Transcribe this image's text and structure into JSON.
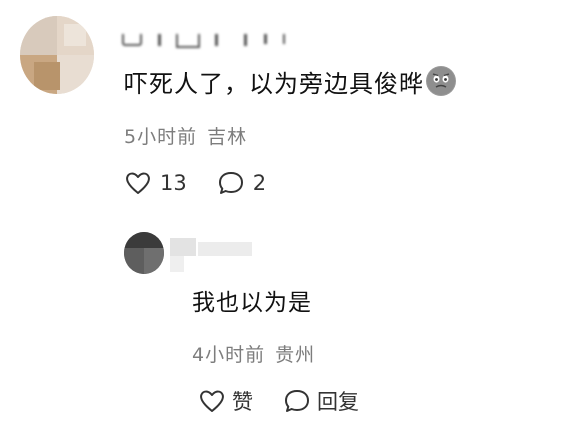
{
  "comment": {
    "text": "吓死人了，以为旁边具俊晔",
    "emoji_icon": "grimace-face-emoji",
    "time": "5小时前",
    "location": "吉林",
    "likes": "13",
    "replies": "2"
  },
  "reply": {
    "text": "我也以为是",
    "time": "4小时前",
    "location": "贵州",
    "like_label": "赞",
    "reply_label": "回复"
  }
}
